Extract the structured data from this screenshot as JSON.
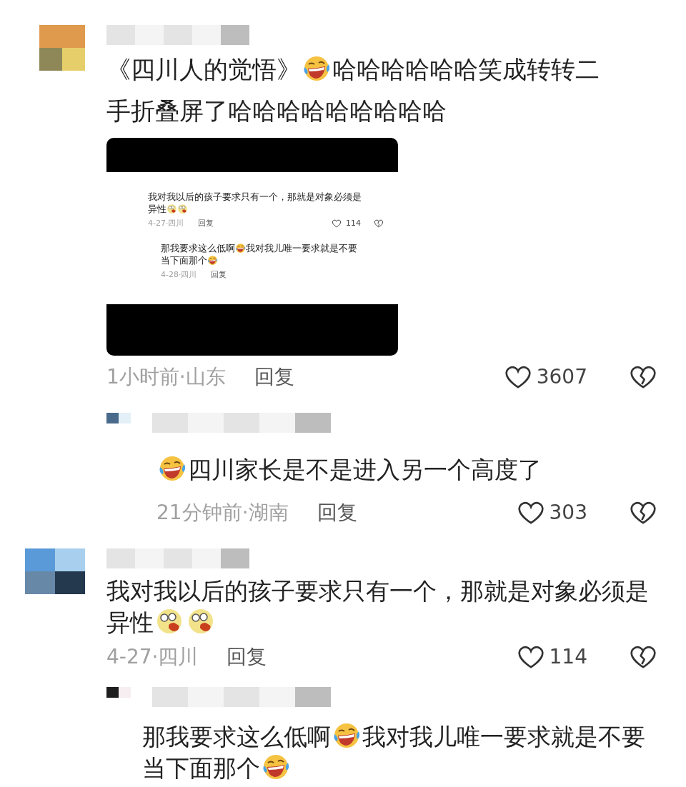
{
  "comments": [
    {
      "lines": [
        [
          {
            "kind": "text",
            "text": "《四川人的觉悟》"
          },
          {
            "kind": "laughing"
          },
          {
            "kind": "text",
            "text": "哈哈哈哈哈哈笑成转转二"
          }
        ],
        [
          {
            "kind": "text",
            "text": "手折叠屏了哈哈哈哈哈哈哈哈哈"
          }
        ]
      ],
      "embed": {
        "comments": [
          {
            "lines": [
              [
                {
                  "kind": "text",
                  "text": "我对我以后的孩子要求只有一个，那就是对象必须是"
                }
              ],
              [
                {
                  "kind": "text",
                  "text": "异性"
                },
                {
                  "kind": "shocked"
                },
                {
                  "kind": "shocked"
                }
              ]
            ],
            "meta": {
              "time": "4-27·四川",
              "reply": "回复",
              "likes": "114"
            }
          },
          {
            "lines": [
              [
                {
                  "kind": "text",
                  "text": "那我要求这么低啊"
                },
                {
                  "kind": "laughing"
                },
                {
                  "kind": "text",
                  "text": "我对我儿唯一要求就是不要"
                }
              ],
              [
                {
                  "kind": "text",
                  "text": "当下面那个"
                },
                {
                  "kind": "laughing"
                }
              ]
            ],
            "meta": {
              "time": "4-28·四川",
              "reply": "回复"
            }
          }
        ]
      },
      "meta": {
        "time": "1小时前·山东",
        "reply": "回复",
        "likes": "3607"
      },
      "replies": [
        {
          "lines": [
            [
              {
                "kind": "laughing"
              },
              {
                "kind": "text",
                "text": "四川家长是不是进入另一个高度了"
              }
            ]
          ],
          "meta": {
            "time": "21分钟前·湖南",
            "reply": "回复",
            "likes": "303"
          }
        }
      ]
    },
    {
      "lines": [
        [
          {
            "kind": "text",
            "text": "我对我以后的孩子要求只有一个，那就是对象必须是"
          }
        ],
        [
          {
            "kind": "text",
            "text": "异性"
          },
          {
            "kind": "shocked"
          },
          {
            "kind": "shocked"
          }
        ]
      ],
      "meta": {
        "time": "4-27·四川",
        "reply": "回复",
        "likes": "114"
      },
      "replies": [
        {
          "lines": [
            [
              {
                "kind": "text",
                "text": "那我要求这么低啊"
              },
              {
                "kind": "laughing"
              },
              {
                "kind": "text",
                "text": "我对我儿唯一要求就是不要"
              }
            ],
            [
              {
                "kind": "text",
                "text": "当下面那个"
              },
              {
                "kind": "laughing"
              }
            ]
          ]
        }
      ]
    }
  ]
}
